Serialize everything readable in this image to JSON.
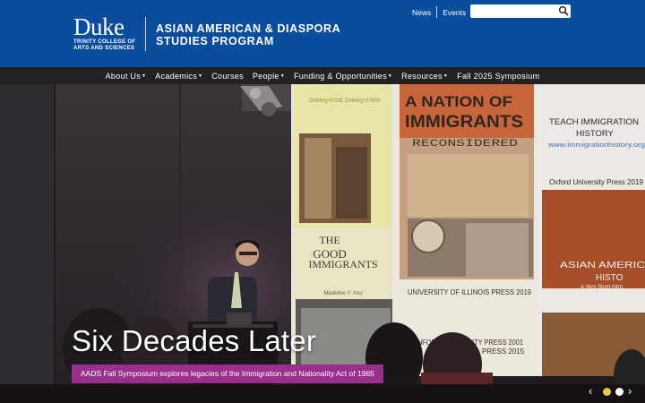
{
  "header": {
    "logo_text": "Duke",
    "logo_sub_line1": "TRINITY COLLEGE OF",
    "logo_sub_line2": "ARTS AND SCIENCES",
    "site_title_line1": "ASIAN AMERICAN & DIASPORA",
    "site_title_line2": "STUDIES PROGRAM",
    "brand_color": "#0a4d9c"
  },
  "utility_nav": {
    "news": "News",
    "events": "Events"
  },
  "search": {
    "placeholder": "",
    "value": "",
    "icon": "search-icon"
  },
  "main_nav": [
    {
      "label": "About Us",
      "dropdown": true
    },
    {
      "label": "Academics",
      "dropdown": true
    },
    {
      "label": "Courses",
      "dropdown": false
    },
    {
      "label": "People",
      "dropdown": true
    },
    {
      "label": "Funding & Opportunities",
      "dropdown": true
    },
    {
      "label": "Resources",
      "dropdown": true
    },
    {
      "label": "Fall 2025 Symposium",
      "dropdown": false
    }
  ],
  "hero": {
    "title": "Six Decades Later",
    "caption": "AADS Fall Symposium explores legacies of the Immigration and Nationality Act of 1965",
    "caption_color": "#9b2f8e",
    "slide": {
      "book1_title": "Dreaming of Gold, Dreaming of Home",
      "book2_title_line1": "THE",
      "book2_title_line2": "GOOD",
      "book2_title_line3": "IMMIGRANTS",
      "book2_author": "Madeline Y. Hsu",
      "book3_title_line1": "A NATION OF",
      "book3_title_line2": "IMMIGRANTS",
      "book3_subtitle": "RECONSIDERED",
      "press1": "UNIVERSITY OF ILLINOIS PRESS 2019",
      "press2": "STANFORD UNIVERSITY PRESS 2001",
      "press3": "PRESS 2015",
      "right_heading_line1": "TEACH IMMIGRATION",
      "right_heading_line2": "HISTORY",
      "right_url": "www.immigrationhistory.org",
      "right_press": "Oxford University Press 2019",
      "right_book_line1": "ASIAN AMERIC",
      "right_book_line2": "HISTO",
      "right_book_line3": "A Very Short Intro"
    }
  },
  "carousel": {
    "prev": "‹",
    "next": "›",
    "active_dot_color": "#e6c84a",
    "inactive_dot_color": "#ffffff"
  }
}
